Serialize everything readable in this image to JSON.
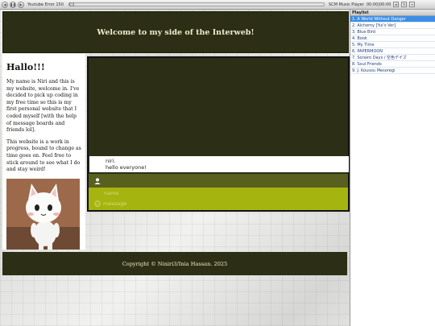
{
  "player": {
    "title": "Youtube Error 150",
    "brand": "SCM Music Player",
    "time": "00:00|00:00"
  },
  "playlist": {
    "header": "Playlist",
    "items": [
      "1. A World Without Danger",
      "2. Alchemy [Yui's Ver]",
      "3. Blue Bird",
      "4. Book",
      "5. My Time",
      "6. PAPERMOON",
      "7. Sorairo Days / 空色デイズ",
      "8. Soul Friends",
      "9. J. Kousou Mesoregi"
    ],
    "active_index": 0
  },
  "site": {
    "header_title": "Welcome to my side of the Interweb!",
    "intro": {
      "heading": "Hallo!!!",
      "p1": "My name is Niri and this is my website, welcome in. I've decided to pick up coding in my free time so this is my first personal website that I coded myself [with the help of message boards and friends lol].",
      "p2": "This website is a work in progress, bound to change as time goes on. Feel free to stick around to see what I do and stay weird!"
    },
    "chat": {
      "log_name": "niri.",
      "log_message": "hello everyone!",
      "name_placeholder": "name",
      "message_placeholder": "message"
    },
    "footer": "Copyright © Niniri3/Inia Hassan. 2025"
  },
  "colors": {
    "header_bg": "#2c2f15",
    "chat_user_bar": "#595f1e",
    "chat_form": "#a5b40e",
    "playlist_active": "#3d8ee6"
  }
}
